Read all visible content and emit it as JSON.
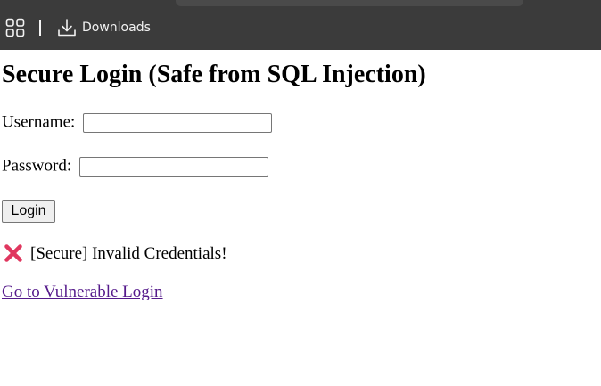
{
  "toolbar": {
    "apps_icon": "apps-grid-icon",
    "download_icon": "download-icon",
    "downloads_label": "Downloads",
    "background": "#3b3b3b"
  },
  "page": {
    "title": "Secure Login (Safe from SQL Injection)",
    "username_label": "Username:",
    "username_value": "",
    "password_label": "Password:",
    "password_value": "",
    "login_button": "Login",
    "message_icon": "cross-mark-icon",
    "message_text": "[Secure] Invalid Credentials!",
    "link_text": "Go to Vulnerable Login",
    "link_color": "#551a8b",
    "error_icon_color": "#e0375f"
  }
}
